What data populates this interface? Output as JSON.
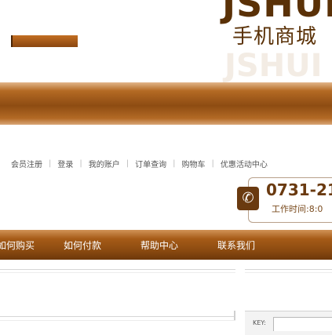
{
  "header": {
    "logo_text": "JSHUI",
    "logo_subtitle": "手机商城",
    "logo_ghost": "JSHUI"
  },
  "top_links": [
    {
      "label": "会员注册"
    },
    {
      "label": "登录"
    },
    {
      "label": "我的账户"
    },
    {
      "label": "订单查询"
    },
    {
      "label": "购物车"
    },
    {
      "label": "优惠活动中心"
    }
  ],
  "contact": {
    "phone": "0731-21",
    "hours": "工作时间:8:0",
    "icon": "phone-icon"
  },
  "main_nav": [
    {
      "label": "如何购买"
    },
    {
      "label": "如何付款"
    },
    {
      "label": "帮助中心"
    },
    {
      "label": "联系我们"
    }
  ],
  "search": {
    "label": "KEY:",
    "value": ""
  },
  "colors": {
    "brand": "#5a3107",
    "nav_bar": "#8a4a10"
  }
}
